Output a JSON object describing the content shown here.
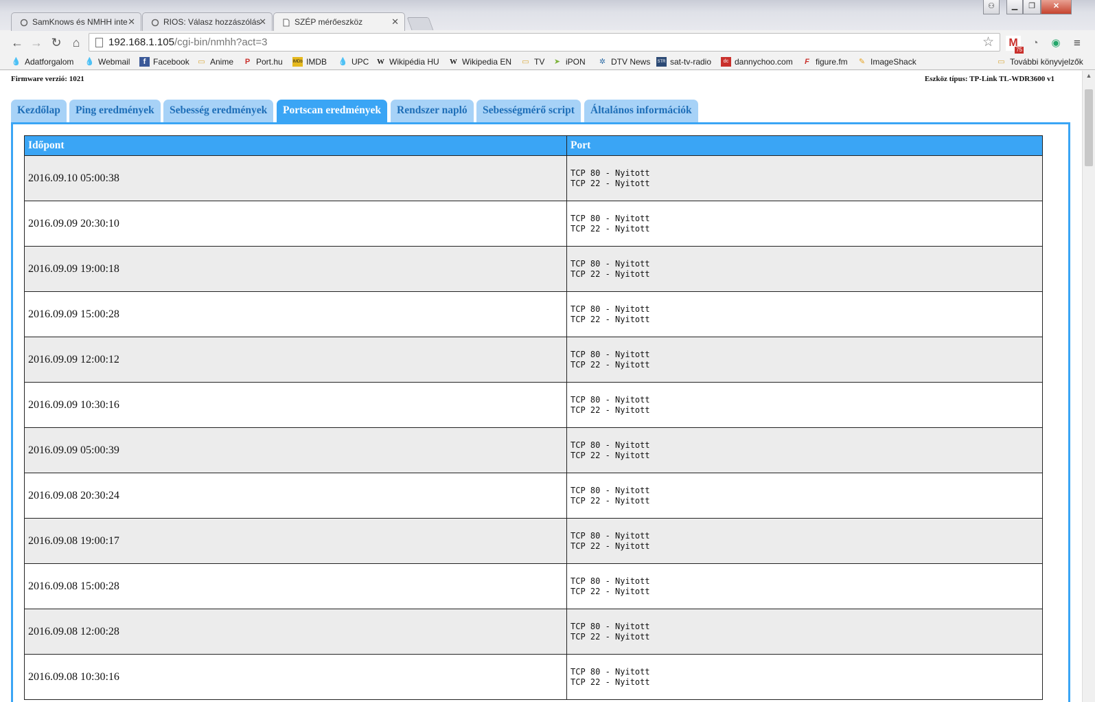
{
  "browser": {
    "tabs": [
      {
        "title": "SamKnows és NMHH inte",
        "active": false
      },
      {
        "title": "RIOS: Válasz hozzászólás",
        "active": false
      },
      {
        "title": "SZÉP mérőeszköz",
        "active": true
      }
    ],
    "url_host": "192.168.1.105",
    "url_path": "/cgi-bin/nmhh?act=3",
    "extension_badge": "75",
    "bookmarks": [
      "Adatforgalom",
      "Webmail",
      "Facebook",
      "Anime",
      "Port.hu",
      "IMDB",
      "UPC",
      "Wikipédia HU",
      "Wikipedia EN",
      "TV",
      "iPON",
      "DTV News",
      "sat-tv-radio",
      "dannychoo.com",
      "figure.fm",
      "ImageShack"
    ],
    "other_bookmarks": "További könyvjelzők"
  },
  "page": {
    "firmware": "Firmware verzió: 1021",
    "device": "Eszköz típus: TP-Link TL-WDR3600 v1",
    "nav_tabs": [
      {
        "label": "Kezdőlap",
        "active": false
      },
      {
        "label": "Ping eredmények",
        "active": false
      },
      {
        "label": "Sebesség eredmények",
        "active": false
      },
      {
        "label": "Portscan eredmények",
        "active": true
      },
      {
        "label": "Rendszer napló",
        "active": false
      },
      {
        "label": "Sebességmérő script",
        "active": false
      },
      {
        "label": "Általános információk",
        "active": false
      }
    ],
    "table": {
      "headers": [
        "Időpont",
        "Port"
      ],
      "rows": [
        {
          "time": "2016.09.10 05:00:38",
          "ports": [
            "TCP 80 - Nyitott",
            "TCP 22 - Nyitott"
          ]
        },
        {
          "time": "2016.09.09 20:30:10",
          "ports": [
            "TCP 80 - Nyitott",
            "TCP 22 - Nyitott"
          ]
        },
        {
          "time": "2016.09.09 19:00:18",
          "ports": [
            "TCP 80 - Nyitott",
            "TCP 22 - Nyitott"
          ]
        },
        {
          "time": "2016.09.09 15:00:28",
          "ports": [
            "TCP 80 - Nyitott",
            "TCP 22 - Nyitott"
          ]
        },
        {
          "time": "2016.09.09 12:00:12",
          "ports": [
            "TCP 80 - Nyitott",
            "TCP 22 - Nyitott"
          ]
        },
        {
          "time": "2016.09.09 10:30:16",
          "ports": [
            "TCP 80 - Nyitott",
            "TCP 22 - Nyitott"
          ]
        },
        {
          "time": "2016.09.09 05:00:39",
          "ports": [
            "TCP 80 - Nyitott",
            "TCP 22 - Nyitott"
          ]
        },
        {
          "time": "2016.09.08 20:30:24",
          "ports": [
            "TCP 80 - Nyitott",
            "TCP 22 - Nyitott"
          ]
        },
        {
          "time": "2016.09.08 19:00:17",
          "ports": [
            "TCP 80 - Nyitott",
            "TCP 22 - Nyitott"
          ]
        },
        {
          "time": "2016.09.08 15:00:28",
          "ports": [
            "TCP 80 - Nyitott",
            "TCP 22 - Nyitott"
          ]
        },
        {
          "time": "2016.09.08 12:00:28",
          "ports": [
            "TCP 80 - Nyitott",
            "TCP 22 - Nyitott"
          ]
        },
        {
          "time": "2016.09.08 10:30:16",
          "ports": [
            "TCP 80 - Nyitott",
            "TCP 22 - Nyitott"
          ]
        }
      ]
    }
  },
  "colors": {
    "tab_active": "#3aa5f5",
    "tab_inactive": "#a7d2f7",
    "tab_text": "#1f6fb8",
    "row_alt": "#ececec"
  }
}
